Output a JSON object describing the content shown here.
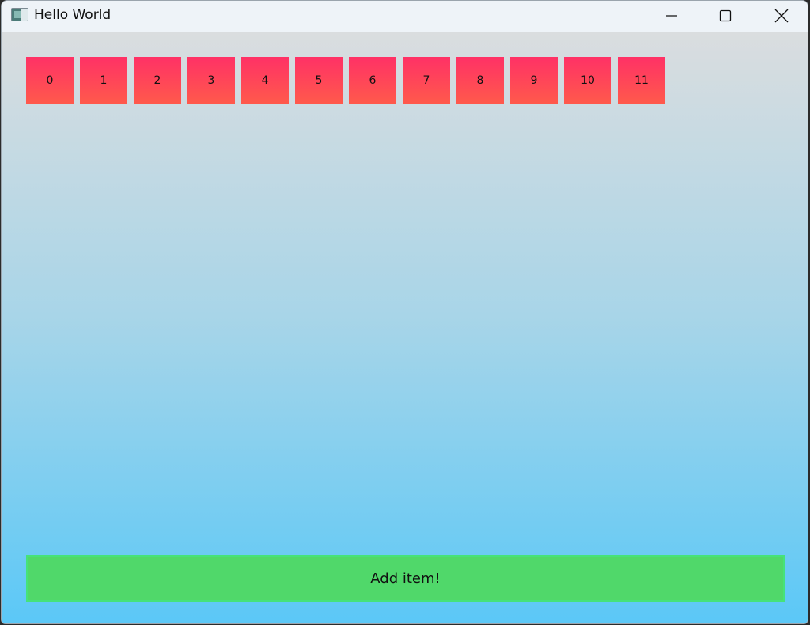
{
  "window": {
    "title": "Hello World",
    "app_icon": "window-app-icon",
    "controls": {
      "minimize_icon": "minimize-icon",
      "maximize_icon": "maximize-icon",
      "close_icon": "close-icon"
    }
  },
  "items": [
    "0",
    "1",
    "2",
    "3",
    "4",
    "5",
    "6",
    "7",
    "8",
    "9",
    "10",
    "11"
  ],
  "add_button": {
    "label": "Add item!",
    "color": "#50d86a"
  },
  "colors": {
    "item_top": "#ff3166",
    "item_bottom": "#ff5a4b",
    "background_top": "#dadddf",
    "background_bottom": "#5bc8f7"
  }
}
